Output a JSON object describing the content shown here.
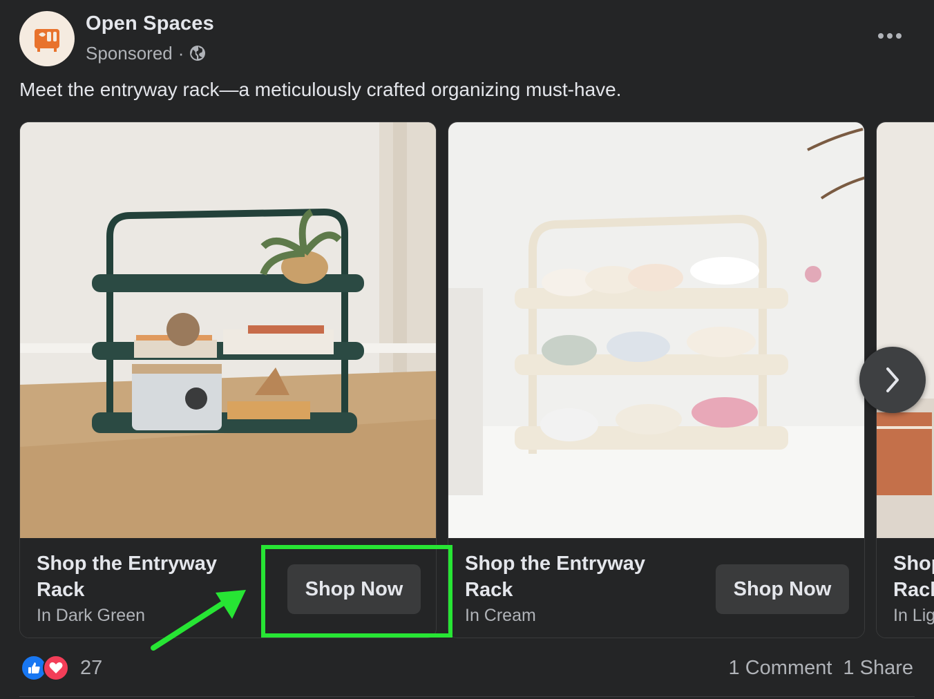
{
  "post": {
    "page_name": "Open Spaces",
    "sponsored_label": "Sponsored",
    "separator": "·",
    "text": "Meet the entryway rack—a meticulously crafted organizing must-have.",
    "brand_color": "#e8722c"
  },
  "carousel": {
    "cards": [
      {
        "title": "Shop the Entryway Rack",
        "subtitle": "In Dark Green",
        "cta": "Shop Now"
      },
      {
        "title": "Shop the Entryway Rack",
        "subtitle": "In Cream",
        "cta": "Shop Now"
      },
      {
        "title": "Shop the Entryway Rack",
        "subtitle": "In Lig"
      }
    ]
  },
  "footer": {
    "reaction_count": "27",
    "comments": "1 Comment",
    "shares": "1 Share"
  },
  "annotation": {
    "highlight_color": "#27e534"
  }
}
